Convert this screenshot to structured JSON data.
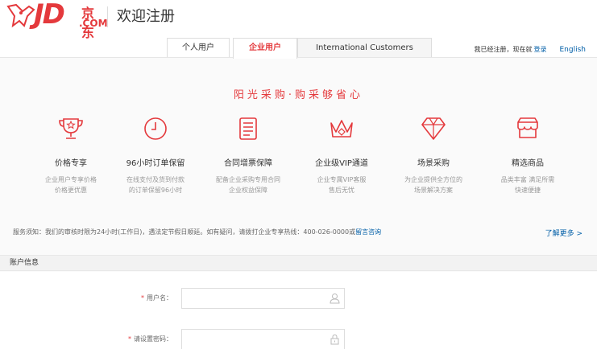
{
  "header": {
    "logo_jd": "JD",
    "logo_cn": "京东",
    "logo_com": ".COM",
    "page_title": "欢迎注册"
  },
  "tabs": [
    {
      "label": "个人用户",
      "active": false
    },
    {
      "label": "企业用户",
      "active": true
    },
    {
      "label": "International Customers",
      "active": false
    }
  ],
  "top_right": {
    "text": "我已经注册，现在就",
    "login_label": "登录",
    "english_label": "English"
  },
  "slogan": "阳光采购·购采够省心",
  "features": [
    {
      "icon": "trophy-icon",
      "title": "价格专享",
      "desc1": "企业用户专享价格",
      "desc2": "价格更优惠"
    },
    {
      "icon": "clock-icon",
      "title": "96小时订单保留",
      "desc1": "在线支付及货到付款",
      "desc2": "的订单保留96小时"
    },
    {
      "icon": "document-icon",
      "title": "合同增票保障",
      "desc1": "配备企业采购专用合同",
      "desc2": "企业权益保障"
    },
    {
      "icon": "crown-icon",
      "title": "企业级VIP通道",
      "desc1": "企业专属VIP客服",
      "desc2": "售后无忧"
    },
    {
      "icon": "diamond-icon",
      "title": "场景采购",
      "desc1": "为企业提供全方位的",
      "desc2": "场景解决方案"
    },
    {
      "icon": "shop-icon",
      "title": "精选商品",
      "desc1": "品类丰富 满足所需",
      "desc2": "快速便捷"
    }
  ],
  "notice": {
    "text": "服务须知：我们的审核时限为24小时(工作日)，遇法定节假日顺延。如有疑问，请拨打企业专享热线：400-026-0000或",
    "link": "留言咨询",
    "more": "了解更多 >"
  },
  "account_section": "账户信息",
  "form": {
    "username_label": "用户名：",
    "password_label": "请设置密码：",
    "required_mark": "*"
  },
  "colors": {
    "brand_red": "#e4393c",
    "link_blue": "#005ea7"
  }
}
